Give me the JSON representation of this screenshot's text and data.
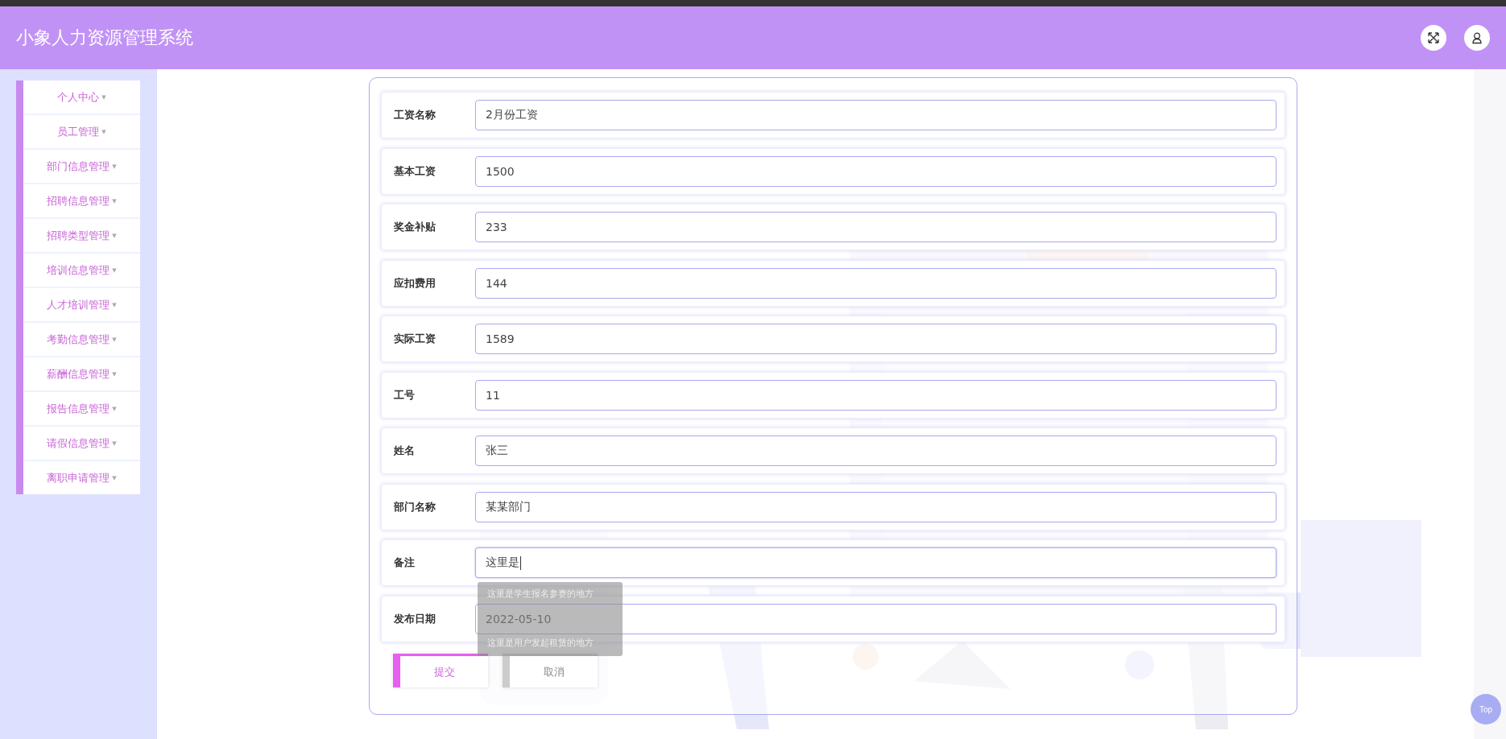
{
  "header": {
    "title": "小象人力资源管理系统"
  },
  "sidebar": {
    "items": [
      {
        "label": "个人中心",
        "caret": "▼"
      },
      {
        "label": "员工管理",
        "caret": "▼"
      },
      {
        "label": "部门信息管理",
        "caret": "▼"
      },
      {
        "label": "招聘信息管理",
        "caret": "▼"
      },
      {
        "label": "招聘类型管理",
        "caret": "▼"
      },
      {
        "label": "培训信息管理",
        "caret": "▼"
      },
      {
        "label": "人才培训管理",
        "caret": "▼"
      },
      {
        "label": "考勤信息管理",
        "caret": "▼"
      },
      {
        "label": "薪酬信息管理",
        "caret": "▼"
      },
      {
        "label": "报告信息管理",
        "caret": "▼"
      },
      {
        "label": "请假信息管理",
        "caret": "▼"
      },
      {
        "label": "离职申请管理",
        "caret": "▼"
      }
    ]
  },
  "form": {
    "fields": [
      {
        "label": "工资名称",
        "value": "2月份工资",
        "focused": false
      },
      {
        "label": "基本工资",
        "value": "1500",
        "focused": false
      },
      {
        "label": "奖金补贴",
        "value": "233",
        "focused": false
      },
      {
        "label": "应扣费用",
        "value": "144",
        "focused": false
      },
      {
        "label": "实际工资",
        "value": "1589",
        "focused": false
      },
      {
        "label": "工号",
        "value": "11",
        "focused": false
      },
      {
        "label": "姓名",
        "value": "张三",
        "focused": false
      },
      {
        "label": "部门名称",
        "value": "某某部门",
        "focused": false
      },
      {
        "label": "备注",
        "value": "这里是",
        "focused": true,
        "suggestions": [
          "这里是学生报名参赛的地方",
          "这里是用户发起租赁的地方"
        ]
      },
      {
        "label": "发布日期",
        "value": "2022-05-10",
        "focused": false
      }
    ],
    "buttons": [
      {
        "label": "提交",
        "kind": "primary"
      },
      {
        "label": "取消",
        "kind": "cancel"
      }
    ]
  },
  "back_to_top": {
    "label": "Top"
  }
}
